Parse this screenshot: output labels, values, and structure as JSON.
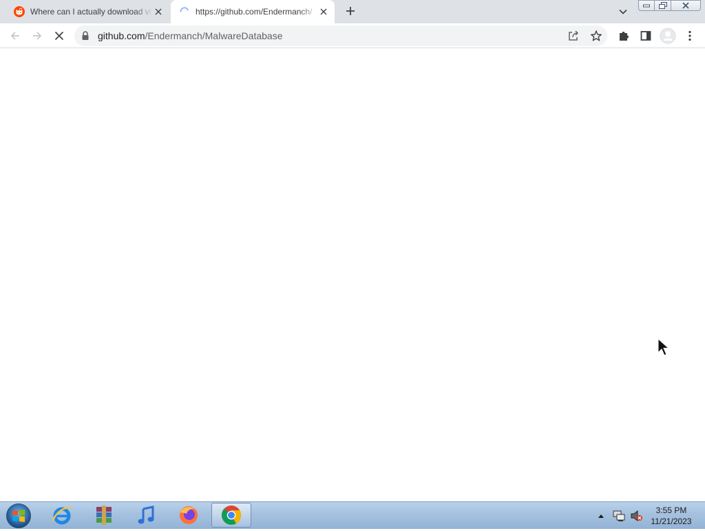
{
  "browser": {
    "tabs": [
      {
        "title": "Where can I actually download vi",
        "favicon": "reddit-icon",
        "active": false
      },
      {
        "title": "https://github.com/Endermanch/",
        "favicon": "loading-spinner-icon",
        "active": true
      }
    ],
    "new_tab_icon": "plus-icon",
    "tab_search_icon": "chevron-down-icon",
    "toolbar": {
      "back_icon": "arrow-left-icon",
      "forward_icon": "arrow-right-icon",
      "stop_icon": "close-icon",
      "extensions_icon": "puzzle-icon",
      "side_panel_icon": "side-panel-icon",
      "profile_icon": "avatar-icon",
      "menu_icon": "kebab-menu-icon"
    },
    "omnibox": {
      "host": "github.com",
      "path": "/Endermanch/MalwareDatabase",
      "lock_icon": "lock-icon",
      "share_icon": "share-icon",
      "bookmark_icon": "star-icon"
    }
  },
  "taskbar": {
    "apps": [
      "internet-explorer-icon",
      "winrar-icon",
      "itunes-icon",
      "firefox-icon",
      "chrome-icon"
    ],
    "active_app": "chrome-icon",
    "clock": {
      "time": "3:55 PM",
      "date": "11/21/2023"
    }
  },
  "colors": {
    "tabstrip": "#dee1e6",
    "reddit": "#ff4500",
    "taskbar": "#a5c1df"
  }
}
